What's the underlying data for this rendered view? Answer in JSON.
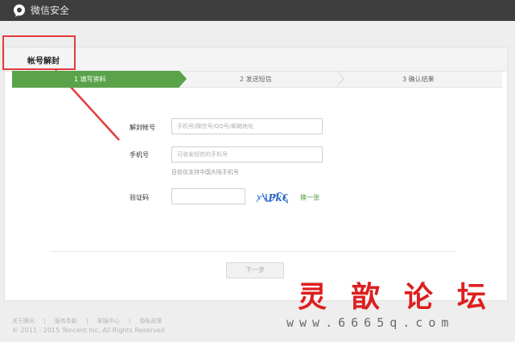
{
  "app": {
    "title": "微信安全",
    "logo_icon": "wechat-chat-bubble-icon"
  },
  "page": {
    "heading": "帐号解封"
  },
  "steps": [
    {
      "label": "1 填写资料",
      "active": true
    },
    {
      "label": "2 发送短信",
      "active": false
    },
    {
      "label": "3 确认结果",
      "active": false
    }
  ],
  "form": {
    "account": {
      "label": "解封帐号",
      "placeholder": "手机号/微信号/QQ号/邮箱地址"
    },
    "phone": {
      "label": "手机号",
      "placeholder": "可收发短信的手机号",
      "hint": "目前仅支持中国大陆手机号"
    },
    "captcha": {
      "label": "验证码",
      "value": "",
      "image_text": "\\PkQ",
      "refresh_label": "换一张"
    },
    "next_label": "下一步"
  },
  "footer": {
    "links": [
      "关于腾讯",
      "|",
      "服务条款",
      "|",
      "客服中心",
      "|",
      "隐私政策"
    ],
    "copyright": "© 2011 - 2015 Tencent Inc. All Rights Reserved"
  },
  "watermark": {
    "title": "灵歆论坛",
    "url": "www.6665q.com"
  },
  "colors": {
    "topbar": "#3d3d3d",
    "accent_green": "#5aa34a",
    "annotation_red": "#e23b3b"
  }
}
